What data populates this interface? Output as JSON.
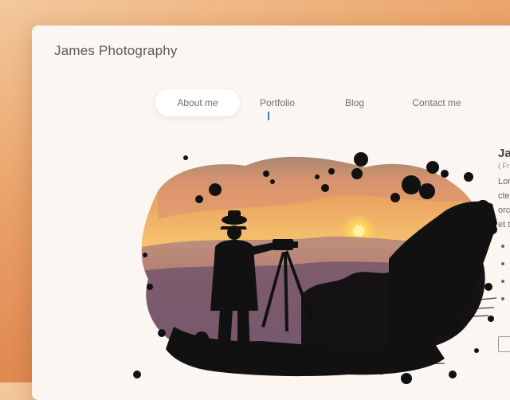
{
  "brand": {
    "name": "James Photography"
  },
  "nav": {
    "items": [
      {
        "label": "About me",
        "active": true
      },
      {
        "label": "Portfolio",
        "active": false
      },
      {
        "label": "Blog",
        "active": false
      },
      {
        "label": "Contact me",
        "active": false
      }
    ]
  },
  "bio": {
    "name": "Ja",
    "subtitle": "( Fr",
    "text_lines": [
      "Lor",
      "cte",
      "orc",
      "et t"
    ],
    "bullet_count": 4
  },
  "hero": {
    "image": "photographer-silhouette-sunset"
  },
  "colors": {
    "background": "#e8995e",
    "card": "#fcf6f3",
    "sun": "#ffd75a",
    "sky_top": "#f4b36a",
    "ink": "#111111"
  }
}
